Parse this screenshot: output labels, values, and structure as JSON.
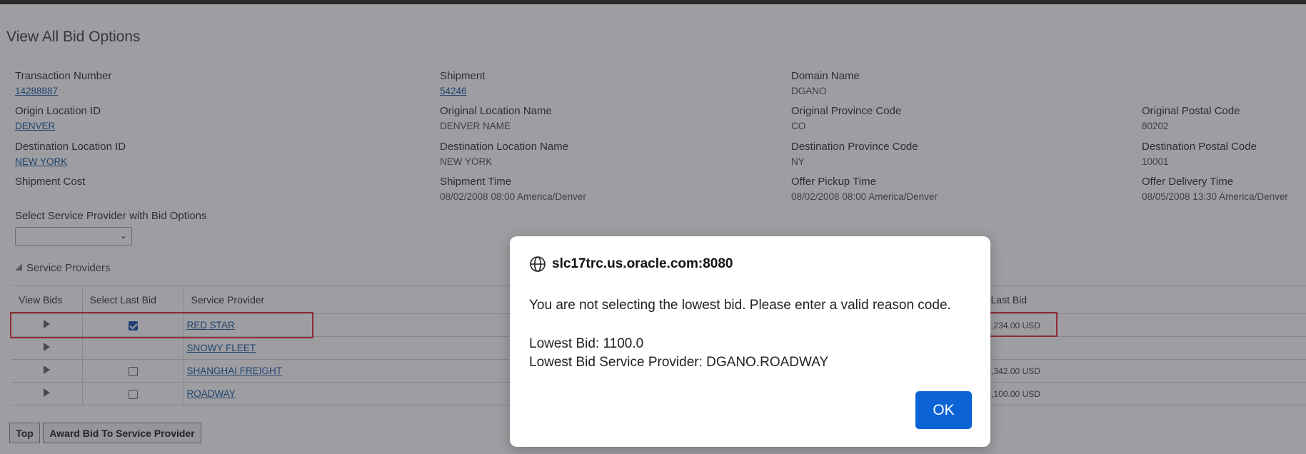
{
  "page": {
    "title": "View All Bid Options"
  },
  "fields": {
    "transaction_number": {
      "label": "Transaction Number",
      "value": "14288887"
    },
    "shipment": {
      "label": "Shipment",
      "value": "54246"
    },
    "domain_name": {
      "label": "Domain Name",
      "value": "DGANO"
    },
    "origin_location_id": {
      "label": "Origin Location ID",
      "value": "DENVER"
    },
    "original_location_name": {
      "label": "Original Location Name",
      "value": "DENVER NAME"
    },
    "original_province_code": {
      "label": "Original Province Code",
      "value": "CO"
    },
    "original_postal_code": {
      "label": "Original Postal Code",
      "value": "80202"
    },
    "destination_location_id": {
      "label": "Destination Location ID",
      "value": "NEW YORK"
    },
    "destination_location_name": {
      "label": "Destination Location Name",
      "value": "NEW YORK"
    },
    "destination_province_code": {
      "label": "Destination Province Code",
      "value": "NY"
    },
    "destination_postal_code": {
      "label": "Destination Postal Code",
      "value": "10001"
    },
    "shipment_cost": {
      "label": "Shipment Cost",
      "value": ""
    },
    "shipment_time": {
      "label": "Shipment Time",
      "value": "08/02/2008 08:00 America/Denver"
    },
    "offer_pickup_time": {
      "label": "Offer Pickup Time",
      "value": "08/02/2008 08:00 America/Denver"
    },
    "offer_delivery_time": {
      "label": "Offer Delivery Time",
      "value": "08/05/2008 13:30 America/Denver"
    }
  },
  "provider_select": {
    "label": "Select Service Provider with Bid Options",
    "value": ""
  },
  "section": {
    "label": "Service Providers"
  },
  "table": {
    "headers": {
      "view_bids": "View Bids",
      "select_last_bid": "Select Last Bid",
      "service_provider": "Service Provider",
      "last_bid": "Last Bid"
    },
    "rows": [
      {
        "provider": "RED STAR",
        "has_checkbox": true,
        "checked": true,
        "last_bid": "1,234.00 USD"
      },
      {
        "provider": "SNOWY FLEET",
        "has_checkbox": false,
        "checked": false,
        "last_bid": ""
      },
      {
        "provider": "SHANGHAI FREIGHT",
        "has_checkbox": true,
        "checked": false,
        "last_bid": "1,342.00 USD"
      },
      {
        "provider": "ROADWAY",
        "has_checkbox": true,
        "checked": false,
        "last_bid": "1,100.00 USD"
      }
    ]
  },
  "buttons": {
    "top": "Top",
    "award": "Award Bid To Service Provider"
  },
  "dialog": {
    "origin": "slc17trc.us.oracle.com:8080",
    "message": "You are not selecting the lowest bid. Please enter a valid reason code.",
    "lowest_bid": "Lowest Bid: 1100.0",
    "lowest_bid_provider": "Lowest Bid Service Provider: DGANO.ROADWAY",
    "ok_label": "OK"
  },
  "icons": {
    "globe": "globe-icon",
    "expander": "triangle-right-icon",
    "chevron": "chevron-down-icon"
  },
  "colors": {
    "link": "#1a5aa0",
    "highlight": "#e23232",
    "ok_button": "#0b63d6"
  }
}
